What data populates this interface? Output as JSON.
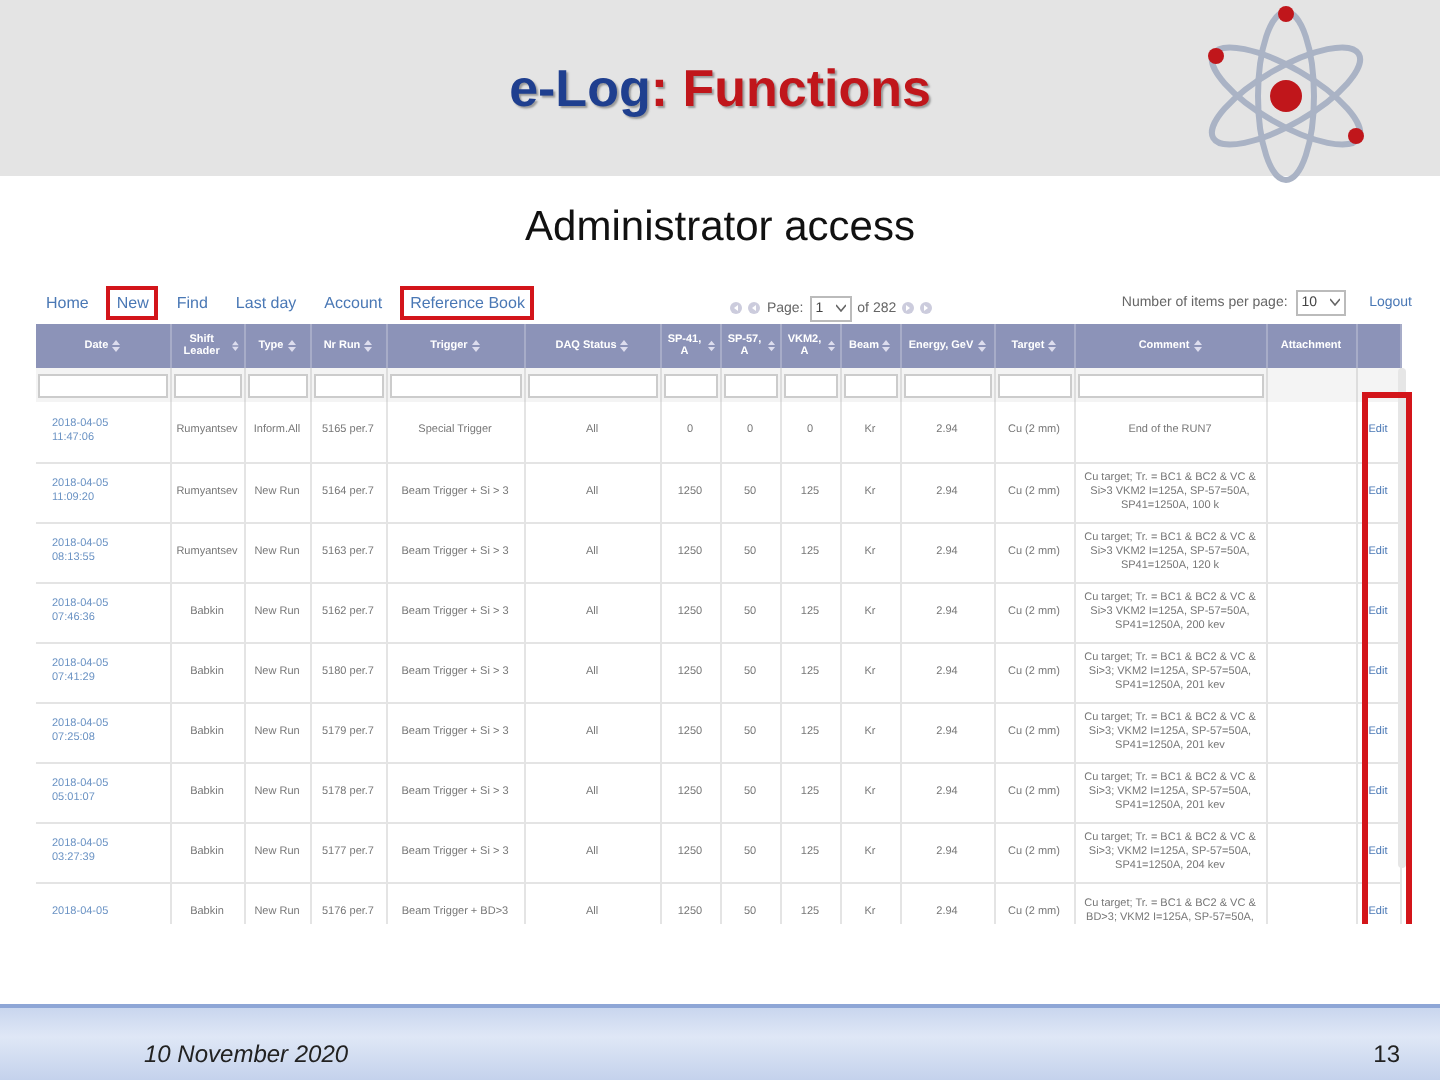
{
  "slide": {
    "title": [
      {
        "text": "e-Log",
        "kind": "brand"
      },
      {
        "text": ": Functions",
        "kind": "main"
      }
    ],
    "subtitle": "Administrator access"
  },
  "nav": [
    {
      "label": "Home",
      "highlighted": false
    },
    {
      "label": "New",
      "highlighted": true
    },
    {
      "label": "Find",
      "highlighted": false
    },
    {
      "label": "Last day",
      "highlighted": false
    },
    {
      "label": "Account",
      "highlighted": false
    },
    {
      "label": "Reference Book",
      "highlighted": true
    }
  ],
  "pager": {
    "page_label": "Page:",
    "page": "1",
    "of_label": "of",
    "total": "282",
    "per_page_label": "Number of items per page:",
    "per_page": "10",
    "logout": "Logout"
  },
  "table": {
    "columns": [
      {
        "label": "Date",
        "sortable": true
      },
      {
        "label": "Shift Leader",
        "sortable": true
      },
      {
        "label": "Type",
        "sortable": true
      },
      {
        "label": "Nr Run",
        "sortable": true
      },
      {
        "label": "Trigger",
        "sortable": true
      },
      {
        "label": "DAQ Status",
        "sortable": true
      },
      {
        "label": "SP-41, A",
        "sortable": true
      },
      {
        "label": "SP-57, A",
        "sortable": true
      },
      {
        "label": "VKM2, A",
        "sortable": true
      },
      {
        "label": "Beam",
        "sortable": true
      },
      {
        "label": "Energy, GeV",
        "sortable": true
      },
      {
        "label": "Target",
        "sortable": true
      },
      {
        "label": "Comment",
        "sortable": true
      },
      {
        "label": "Attachment",
        "sortable": false
      }
    ],
    "edit_column_highlighted": true,
    "rows": [
      {
        "cells": [
          "2018-04-05 11:47:06",
          "Rumyantsev",
          "Inform.All",
          "5165 per.7",
          "Special Trigger",
          "All",
          "0",
          "0",
          "0",
          "Kr",
          "2.94",
          "Cu (2 mm)",
          "End of the RUN7",
          ""
        ],
        "action": "Edit"
      },
      {
        "cells": [
          "2018-04-05 11:09:20",
          "Rumyantsev",
          "New Run",
          "5164 per.7",
          "Beam Trigger + Si > 3",
          "All",
          "1250",
          "50",
          "125",
          "Kr",
          "2.94",
          "Cu (2 mm)",
          "Cu target; Tr. = BC1 & BC2 & VC & Si>3 VKM2 I=125A, SP-57=50A, SP41=1250A, 100 k",
          ""
        ],
        "action": "Edit"
      },
      {
        "cells": [
          "2018-04-05 08:13:55",
          "Rumyantsev",
          "New Run",
          "5163 per.7",
          "Beam Trigger + Si > 3",
          "All",
          "1250",
          "50",
          "125",
          "Kr",
          "2.94",
          "Cu (2 mm)",
          "Cu target; Tr. = BC1 & BC2 & VC & Si>3 VKM2 I=125A, SP-57=50A, SP41=1250A, 120 k",
          ""
        ],
        "action": "Edit"
      },
      {
        "cells": [
          "2018-04-05 07:46:36",
          "Babkin",
          "New Run",
          "5162 per.7",
          "Beam Trigger + Si > 3",
          "All",
          "1250",
          "50",
          "125",
          "Kr",
          "2.94",
          "Cu (2 mm)",
          "Cu target; Tr. = BC1 & BC2 & VC & Si>3 VKM2 I=125A, SP-57=50A, SP41=1250A, 200 kev",
          ""
        ],
        "action": "Edit"
      },
      {
        "cells": [
          "2018-04-05 07:41:29",
          "Babkin",
          "New Run",
          "5180 per.7",
          "Beam Trigger + Si > 3",
          "All",
          "1250",
          "50",
          "125",
          "Kr",
          "2.94",
          "Cu (2 mm)",
          "Cu target; Tr. = BC1 & BC2 & VC & Si>3; VKM2 I=125A, SP-57=50A, SP41=1250A, 201 kev",
          ""
        ],
        "action": "Edit"
      },
      {
        "cells": [
          "2018-04-05 07:25:08",
          "Babkin",
          "New Run",
          "5179 per.7",
          "Beam Trigger + Si > 3",
          "All",
          "1250",
          "50",
          "125",
          "Kr",
          "2.94",
          "Cu (2 mm)",
          "Cu target; Tr. = BC1 & BC2 & VC & Si>3; VKM2 I=125A, SP-57=50A, SP41=1250A, 201 kev",
          ""
        ],
        "action": "Edit"
      },
      {
        "cells": [
          "2018-04-05 05:01:07",
          "Babkin",
          "New Run",
          "5178 per.7",
          "Beam Trigger + Si > 3",
          "All",
          "1250",
          "50",
          "125",
          "Kr",
          "2.94",
          "Cu (2 mm)",
          "Cu target; Tr. = BC1 & BC2 & VC & Si>3; VKM2 I=125A, SP-57=50A, SP41=1250A, 201 kev",
          ""
        ],
        "action": "Edit"
      },
      {
        "cells": [
          "2018-04-05 03:27:39",
          "Babkin",
          "New Run",
          "5177 per.7",
          "Beam Trigger + Si > 3",
          "All",
          "1250",
          "50",
          "125",
          "Kr",
          "2.94",
          "Cu (2 mm)",
          "Cu target; Tr. = BC1 & BC2 & VC & Si>3; VKM2 I=125A, SP-57=50A, SP41=1250A, 204 kev",
          ""
        ],
        "action": "Edit"
      },
      {
        "cells": [
          "2018-04-05",
          "Babkin",
          "New Run",
          "5176 per.7",
          "Beam Trigger + BD>3",
          "All",
          "1250",
          "50",
          "125",
          "Kr",
          "2.94",
          "Cu (2 mm)",
          "Cu target; Tr. = BC1 & BC2 & VC & BD>3; VKM2 I=125A, SP-57=50A,",
          ""
        ],
        "action": "Edit"
      }
    ]
  },
  "footer": {
    "date": "10 November 2020",
    "page_number": "13"
  }
}
